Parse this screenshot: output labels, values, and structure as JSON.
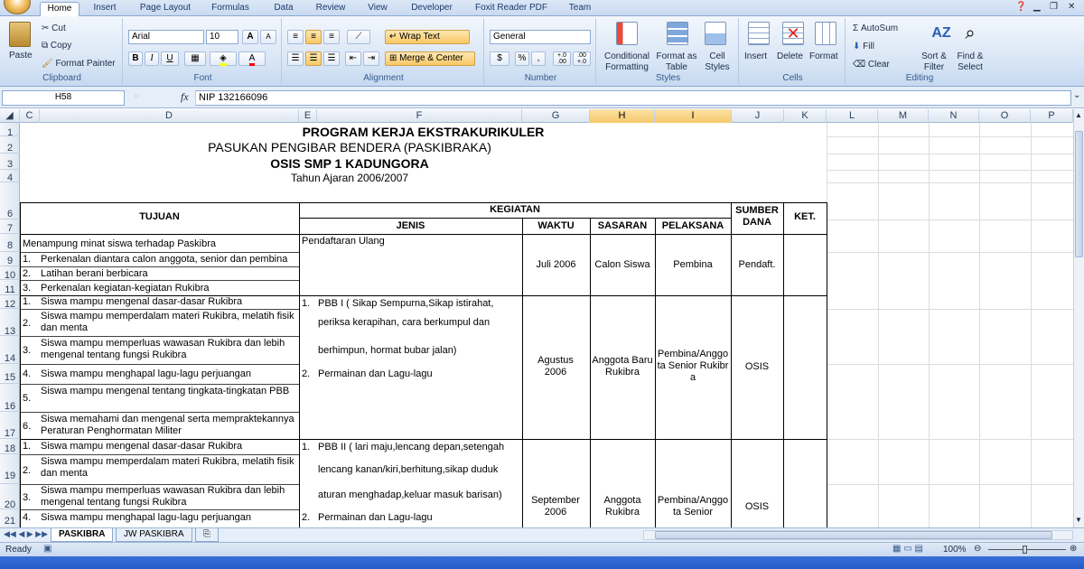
{
  "ribbon": {
    "tabs": [
      "Home",
      "Insert",
      "Page Layout",
      "Formulas",
      "Data",
      "Review",
      "View",
      "Developer",
      "Foxit Reader PDF",
      "Team"
    ],
    "clipboard": {
      "paste": "Paste",
      "cut": "Cut",
      "copy": "Copy",
      "format_painter": "Format Painter",
      "label": "Clipboard"
    },
    "font": {
      "name": "Arial",
      "size": "10",
      "label": "Font",
      "bold": "B",
      "italic": "I",
      "underline": "U",
      "grow": "A",
      "shrink": "A"
    },
    "alignment": {
      "wrap": "Wrap Text",
      "merge": "Merge & Center",
      "label": "Alignment"
    },
    "number": {
      "format": "General",
      "label": "Number",
      "currency": "$",
      "percent": "%",
      "comma": ",",
      "inc": "+.0 .00",
      "dec": ".00 +.0"
    },
    "styles": {
      "conditional": "Conditional Formatting",
      "format_table": "Format as Table",
      "cell_styles": "Cell Styles",
      "label": "Styles"
    },
    "cells": {
      "insert": "Insert",
      "delete": "Delete",
      "format": "Format",
      "label": "Cells"
    },
    "editing": {
      "autosum": "AutoSum",
      "fill": "Fill",
      "clear": "Clear",
      "sort": "Sort & Filter",
      "find": "Find & Select",
      "label": "Editing"
    }
  },
  "formula_bar": {
    "name_box": "H58",
    "fx": "fx",
    "value": "NIP 132166096"
  },
  "columns": [
    "C",
    "D",
    "E",
    "F",
    "G",
    "H",
    "I",
    "J",
    "K",
    "L",
    "M",
    "N",
    "O",
    "P"
  ],
  "selected_columns": [
    "H",
    "I"
  ],
  "rows": [
    "1",
    "2",
    "3",
    "4",
    "6",
    "7",
    "8",
    "9",
    "10",
    "11",
    "12",
    "13",
    "14",
    "15",
    "16",
    "17",
    "18",
    "19",
    "20",
    "21"
  ],
  "sheet": {
    "title1": "PROGRAM KERJA EKSTRAKURIKULER",
    "title2": "PASUKAN PENGIBAR BENDERA (PASKIBRAKA)",
    "title3": "OSIS SMP 1 KADUNGORA",
    "title4": "Tahun Ajaran 2006/2007",
    "h_tujuan": "TUJUAN",
    "h_kegiatan": "KEGIATAN",
    "h_jenis": "JENIS",
    "h_waktu": "WAKTU",
    "h_sasaran": "SASARAN",
    "h_pelaksana": "PELAKSANA",
    "h_sumber": "SUMBER DANA",
    "h_ket": "KET.",
    "tujuan": [
      {
        "n": "",
        "t": "Menampung minat siswa terhadap Paskibra"
      },
      {
        "n": "1.",
        "t": "Perkenalan diantara calon anggota, senior dan pembina"
      },
      {
        "n": "2.",
        "t": "Latihan berani berbicara"
      },
      {
        "n": "3.",
        "t": "Perkenalan kegiatan-kegiatan Rukibra"
      },
      {
        "n": "1.",
        "t": "Siswa mampu mengenal dasar-dasar Rukibra"
      },
      {
        "n": "2.",
        "t": "Siswa mampu memperdalam materi Rukibra, melatih fisik dan menta"
      },
      {
        "n": "3.",
        "t": "Siswa mampu memperluas wawasan Rukibra dan lebih mengenal tentang fungsi Rukibra"
      },
      {
        "n": "4.",
        "t": "Siswa mampu menghapal lagu-lagu perjuangan"
      },
      {
        "n": "5.",
        "t": "Siswa mampu mengenal tentang tingkata-tingkatan PBB"
      },
      {
        "n": "6.",
        "t": "Siswa memahami dan mengenal serta mempraktekannya Peraturan Penghormatan Militer"
      },
      {
        "n": "1.",
        "t": "Siswa mampu mengenal dasar-dasar Rukibra"
      },
      {
        "n": "2.",
        "t": "Siswa mampu memperdalam materi Rukibra, melatih fisik dan menta"
      },
      {
        "n": "3.",
        "t": "Siswa mampu memperluas wawasan Rukibra dan lebih mengenal tentang fungsi Rukibra"
      },
      {
        "n": "4.",
        "t": "Siswa mampu menghapal lagu-lagu perjuangan"
      }
    ],
    "block1": {
      "jenis": "Pendaftaran Ulang",
      "waktu": "Juli 2006",
      "sasaran": "Calon Siswa",
      "pelaksana": "Pembina",
      "sumber": "Pendaft."
    },
    "block2": {
      "j1n": "1.",
      "j1a": "PBB  I ( Sikap Sempurna,Sikap istirahat,",
      "j1b": "periksa kerapihan, cara berkumpul dan",
      "j1c": "berhimpun, hormat bubar jalan)",
      "j2n": "2.",
      "j2": "Permainan dan Lagu-lagu",
      "waktu": "Agustus 2006",
      "sasaran": "Anggota Baru Rukibra",
      "pelaksana": "Pembina/Anggota Senior Rukibra",
      "sumber": "OSIS"
    },
    "block3": {
      "j1n": "1.",
      "j1a": "PBB II ( lari maju,lencang depan,setengah",
      "j1b": "lencang kanan/kiri,berhitung,sikap duduk",
      "j1c": "aturan menghadap,keluar masuk barisan)",
      "j2n": "2.",
      "j2": "Permainan dan Lagu-lagu",
      "waktu": "September 2006",
      "sasaran": "Anggota Rukibra",
      "pelaksana": "Pembina/Anggota Senior",
      "sumber": "OSIS"
    }
  },
  "sheet_tabs": [
    "PASKIBRA",
    "JW PASKIBRA"
  ],
  "status": {
    "ready": "Ready",
    "zoom": "100%"
  }
}
